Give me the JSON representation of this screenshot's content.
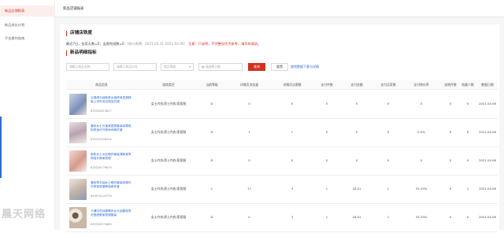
{
  "sidebar": {
    "items": [
      {
        "label": "新品店铺报表",
        "active": true
      },
      {
        "label": "新品成长计划",
        "active": false
      },
      {
        "label": "平台操作指南",
        "active": false
      }
    ]
  },
  "topbar": {
    "tab": "新品店铺报表"
  },
  "section1": {
    "title": "店铺店铁度",
    "info_prefix": "最近7日，金奖天数=0；当周完成数=0",
    "info_note": "（统计周期：2021.03.31-2021.04.06）",
    "info_suffix": "注意：只说明，不完整仅作为参考，请早申请说。"
  },
  "section2": {
    "title": "新品明细指标"
  },
  "filters": {
    "product_name_placeholder": "请输入商品名称",
    "product_id_placeholder": "请输入商品ID号",
    "grade_placeholder": "商品等级",
    "date_placeholder": "请选择日期",
    "query_label": "查询",
    "reset_label": "重置",
    "link_label": "查找数据下载与详情"
  },
  "table": {
    "headers": [
      "商品信息",
      "组商类目",
      "当前等级",
      "详情页浏览量",
      "详情页访客数",
      "支付件数",
      "支付金额",
      "支付买家数",
      "支付转化率",
      "加购件数",
      "收藏人数",
      "数据日期"
    ],
    "rows": [
      {
        "name": "云锦绣长袖新款女装修身显瘦韩版上衣时尚百搭连衣裙",
        "id": "635344415627",
        "category": "女士内衣/男士内衣/家居服",
        "grade": "D",
        "pv": "0",
        "uv": "0",
        "qty": "0",
        "amount": "0",
        "buyers": "0",
        "cvr": "0",
        "cart": "0",
        "fav": "0",
        "date": "2021.04.06"
      },
      {
        "name": "春秋女士长袖家居服套装纯棉宽松舒适可外穿休闲两件套",
        "id": "635332528414",
        "category": "女士内衣/男士内衣/家居服",
        "grade": "D",
        "pv": "1",
        "uv": "1",
        "qty": "0",
        "amount": "0",
        "buyers": "0",
        "cvr": "0.0%",
        "cart": "0",
        "fav": "0",
        "date": "2021.04.06"
      },
      {
        "name": "新款女士冰丝睡衣套装薄款夏季短袖长裤家居服",
        "id": "635326779679",
        "category": "女士内衣/男士内衣/家居服",
        "grade": "D",
        "pv": "0",
        "uv": "0",
        "qty": "0",
        "amount": "0",
        "buyers": "0",
        "cvr": "0",
        "cart": "0",
        "fav": "0",
        "date": "2021.04.06"
      },
      {
        "name": "春秋季长袖女士睡衣套装纯棉可外穿家居服韩版两件套",
        "id": "649974243776",
        "category": "女士内衣/男士内衣/家居服",
        "grade": "C",
        "pv": "17",
        "uv": "3",
        "qty": "1",
        "amount": "18.51",
        "buyers": "1",
        "cvr": "33.33%",
        "cart": "0",
        "fav": "1",
        "date": "2021.04.06"
      },
      {
        "name": "卡通印花纯棉睡衣女长袖春秋季可爱甜美家居服套装",
        "id": "635326570685",
        "category": "女士内衣/男士内衣/家居服",
        "grade": "D",
        "pv": "0",
        "uv": "3",
        "qty": "1",
        "amount": "18.51",
        "buyers": "1",
        "cvr": "33.33%",
        "cart": "0",
        "fav": "0",
        "date": "2021.04.06"
      }
    ]
  },
  "watermark": "晨天网络",
  "colors": {
    "accent": "#d4301f",
    "link": "#2f6bd3"
  }
}
